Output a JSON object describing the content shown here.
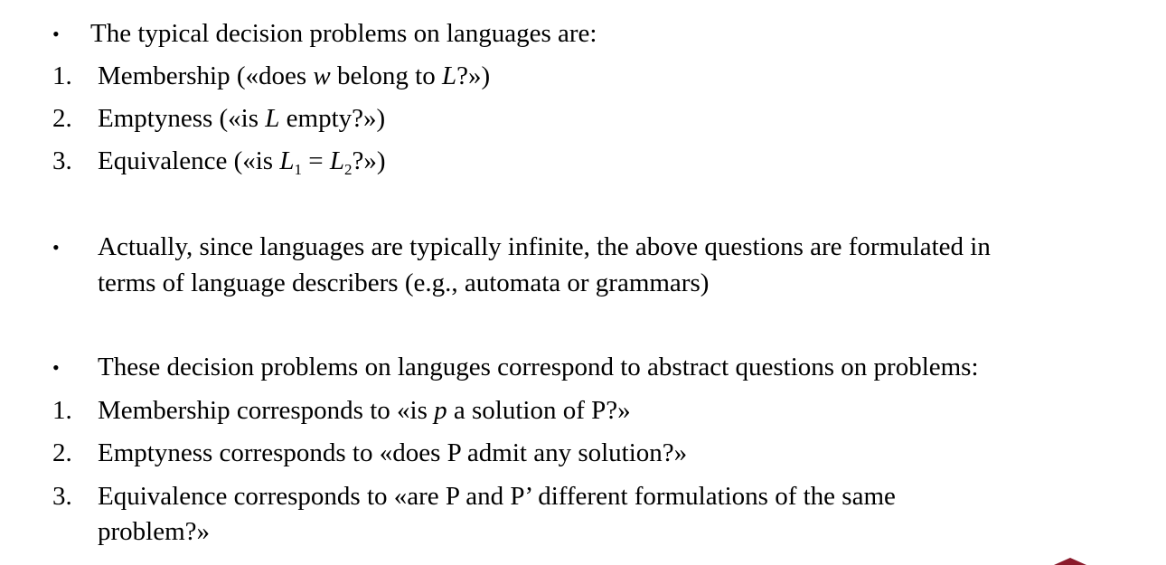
{
  "colors": {
    "text": "#000000",
    "accent": "#8b1a2b"
  },
  "section1": {
    "intro": "The typical decision problems on languages are:",
    "items": [
      {
        "num": "1.",
        "a": "Membership («does ",
        "var1": "w",
        "b": " belong to ",
        "var2": "L",
        "c": "?»)"
      },
      {
        "num": "2.",
        "a": "Emptyness («is ",
        "var1": "L",
        "b": " empty?»)"
      },
      {
        "num": "3.",
        "a": "Equivalence («is ",
        "var1": "L",
        "sub1": "1",
        "eq": " = ",
        "var2": "L",
        "sub2": "2",
        "c": "?»)"
      }
    ]
  },
  "section2": {
    "line1": "Actually, since languages are typically infinite, the above questions are formulated in",
    "line2": "terms of language describers (e.g., automata or grammars)"
  },
  "section3": {
    "intro": "These decision problems on languges correspond to abstract questions on problems:",
    "items": [
      {
        "num": "1.",
        "a": "Membership corresponds to «is ",
        "var1": "p",
        "b": " a solution of P?»"
      },
      {
        "num": "2.",
        "text": "Emptyness corresponds to «does P admit any solution?»"
      },
      {
        "num": "3.",
        "line1": "Equivalence corresponds to «are P and P’ different formulations of the same",
        "line2": "problem?»"
      }
    ]
  }
}
